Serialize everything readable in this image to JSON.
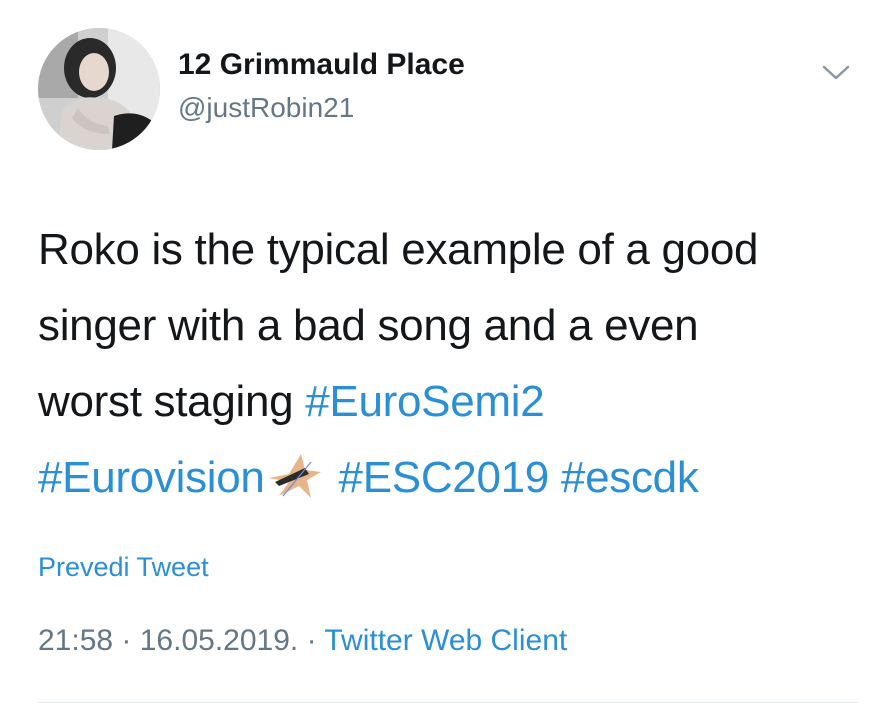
{
  "user": {
    "display_name": "12 Grimmauld Place",
    "handle": "@justRobin21"
  },
  "tweet": {
    "line1": "Roko is the typical example of a good",
    "line2": "singer with a bad song and a even",
    "line3_text": "worst staging ",
    "hashtags": [
      "#EuroSemi2",
      "#Eurovision",
      "#ESC2019",
      "#escdk"
    ],
    "emoji": "eurovision-star-emoji"
  },
  "translate_label": "Prevedi Tweet",
  "meta": {
    "time": "21:58",
    "separator": " · ",
    "date": "16.05.2019.",
    "separator2": " · ",
    "client": "Twitter Web Client"
  },
  "colors": {
    "link": "#2b8fd6",
    "secondary_text": "#657786",
    "primary_text": "#14171a"
  }
}
